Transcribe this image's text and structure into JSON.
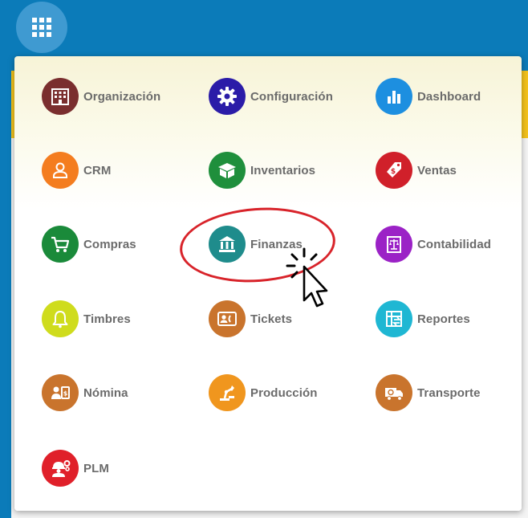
{
  "topbar": {
    "apps_button_icon": "grid-icon"
  },
  "apps": [
    {
      "label": "Organización",
      "icon": "building-icon",
      "color": "#7a2e2e"
    },
    {
      "label": "Configuración",
      "icon": "gear-icon",
      "color": "#2b1ca8"
    },
    {
      "label": "Dashboard",
      "icon": "bar-chart-icon",
      "color": "#1d8fe0"
    },
    {
      "label": "CRM",
      "icon": "person-icon",
      "color": "#f47d1f"
    },
    {
      "label": "Inventarios",
      "icon": "box-icon",
      "color": "#1f8f3c"
    },
    {
      "label": "Ventas",
      "icon": "price-tag-icon",
      "color": "#d0202a"
    },
    {
      "label": "Compras",
      "icon": "shopping-cart-icon",
      "color": "#1a8a3a"
    },
    {
      "label": "Finanzas",
      "icon": "bank-icon",
      "color": "#1f8c8c"
    },
    {
      "label": "Contabilidad",
      "icon": "ledger-scale-icon",
      "color": "#9b22c6"
    },
    {
      "label": "Timbres",
      "icon": "bell-icon",
      "color": "#cfdc1d"
    },
    {
      "label": "Tickets",
      "icon": "ticket-icon",
      "color": "#c9742d"
    },
    {
      "label": "Reportes",
      "icon": "report-icon",
      "color": "#1fb7d3"
    },
    {
      "label": "Nómina",
      "icon": "payroll-icon",
      "color": "#c9742d"
    },
    {
      "label": "Producción",
      "icon": "factory-robot-icon",
      "color": "#f0961e"
    },
    {
      "label": "Transporte",
      "icon": "truck-icon",
      "color": "#c9742d"
    },
    {
      "label": "PLM",
      "icon": "worker-gears-icon",
      "color": "#e0202a"
    }
  ],
  "annotation": {
    "highlighted_app": "Finanzas",
    "cursor": "click-cursor-icon"
  }
}
